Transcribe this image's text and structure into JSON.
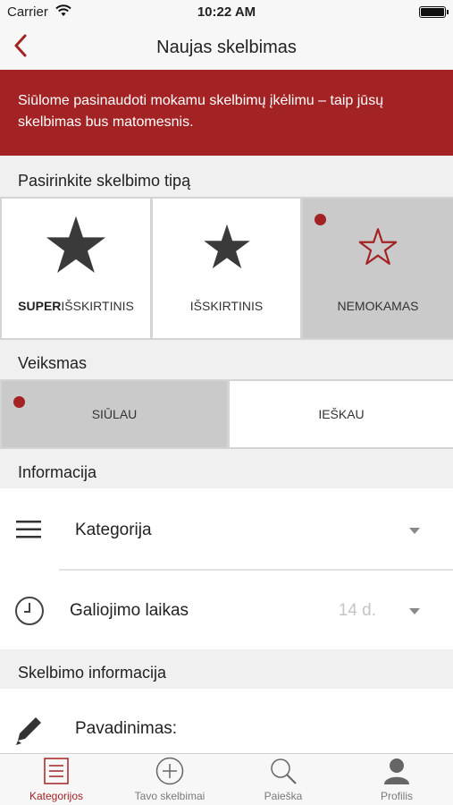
{
  "status_bar": {
    "carrier": "Carrier",
    "time": "10:22 AM"
  },
  "nav": {
    "title": "Naujas skelbimas",
    "back_icon": "chevron-left-icon"
  },
  "banner": {
    "text": "Siūlome pasinaudoti mokamu skelbimų įkėlimu – taip jūsų skelbimas bus matomesnis."
  },
  "ad_type": {
    "header": "Pasirinkite skelbimo tipą",
    "options": [
      {
        "label_bold": "SUPER",
        "label": "IŠSKIRTINIS",
        "icon": "star-filled-large-icon",
        "selected": false
      },
      {
        "label_bold": "",
        "label": "IŠSKIRTINIS",
        "icon": "star-filled-icon",
        "selected": false
      },
      {
        "label_bold": "",
        "label": "NEMOKAMAS",
        "icon": "star-outline-icon",
        "selected": true
      }
    ]
  },
  "action": {
    "header": "Veiksmas",
    "options": [
      {
        "label": "SIŪLAU",
        "selected": true
      },
      {
        "label": "IEŠKAU",
        "selected": false
      }
    ]
  },
  "info": {
    "header": "Informacija",
    "category": {
      "label": "Kategorija",
      "icon": "menu-icon"
    },
    "validity": {
      "label": "Galiojimo laikas",
      "value": "14 d.",
      "icon": "clock-icon"
    }
  },
  "details": {
    "header": "Skelbimo informacija",
    "title_field": {
      "label": "Pavadinimas:",
      "icon": "pencil-icon"
    }
  },
  "tabs": [
    {
      "label": "Kategorijos",
      "icon": "list-icon",
      "active": true
    },
    {
      "label": "Tavo skelbimai",
      "icon": "plus-circle-icon",
      "active": false
    },
    {
      "label": "Paieška",
      "icon": "search-icon",
      "active": false
    },
    {
      "label": "Profilis",
      "icon": "user-icon",
      "active": false
    }
  ],
  "colors": {
    "accent": "#a32324",
    "selected_tile": "#cacaca",
    "background": "#f0f0f0"
  }
}
